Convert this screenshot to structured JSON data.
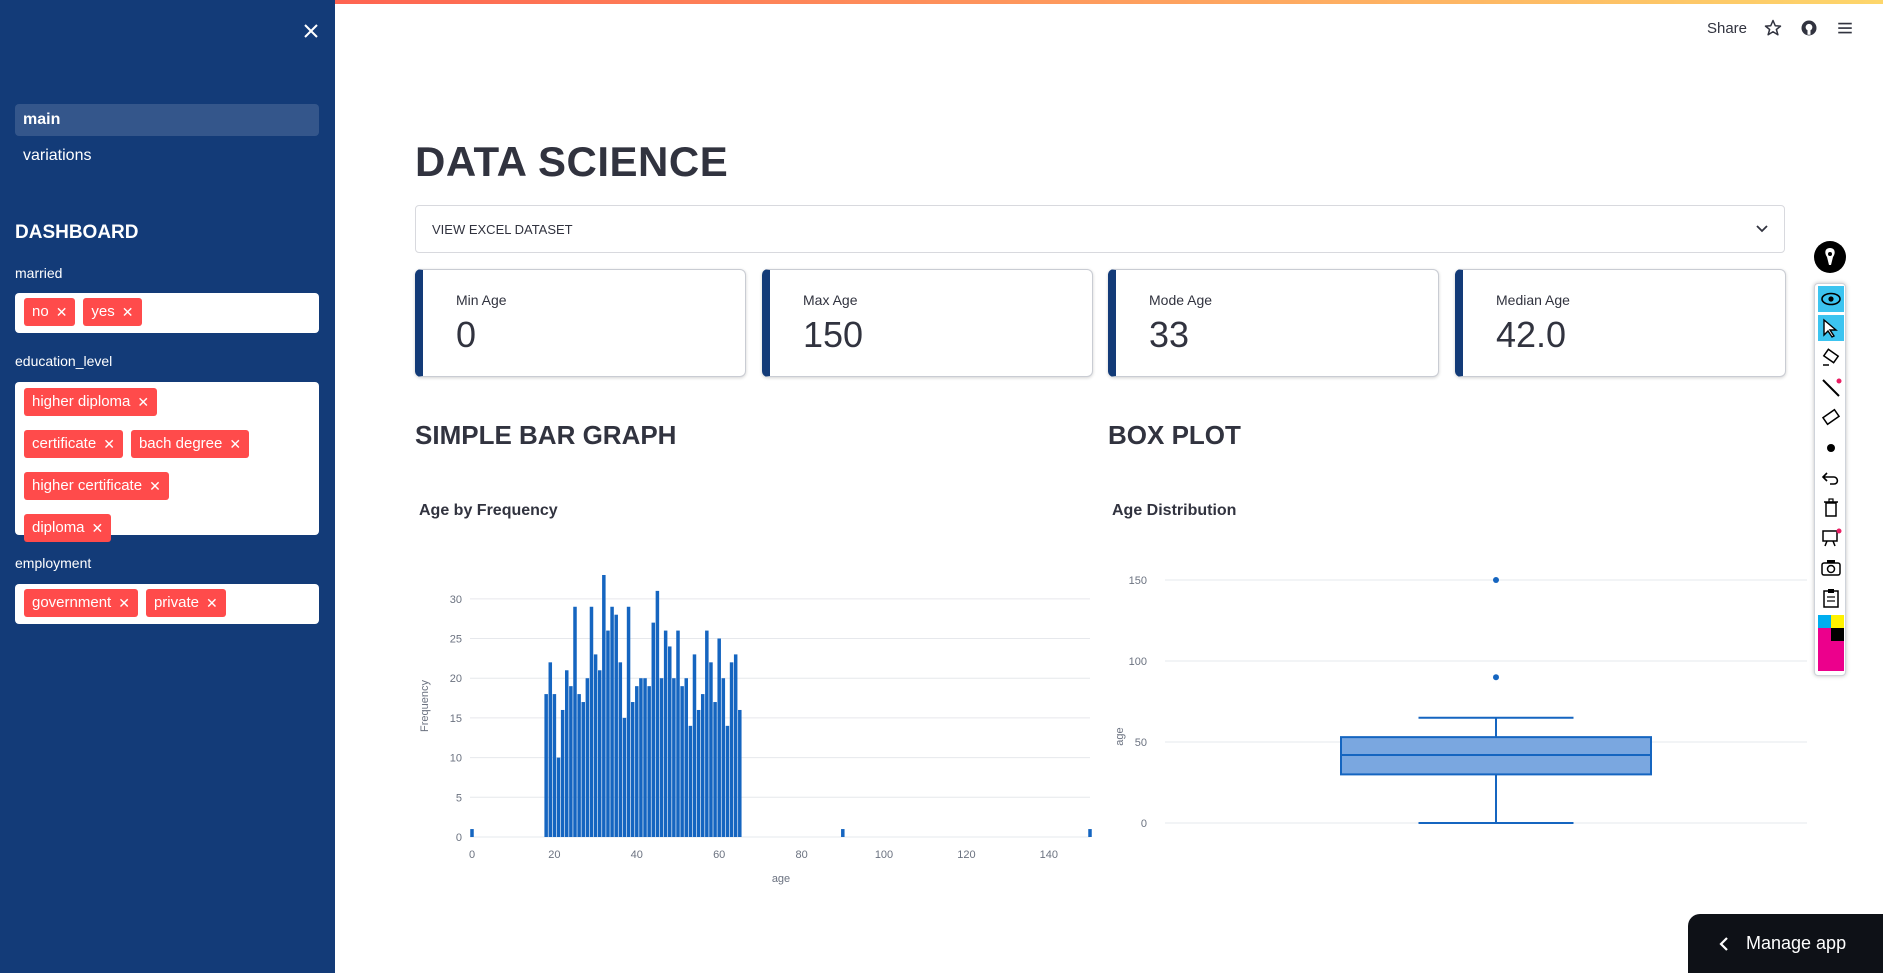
{
  "sidebar": {
    "nav": [
      {
        "label": "main",
        "active": true
      },
      {
        "label": "variations",
        "active": false
      }
    ],
    "heading": "DASHBOARD",
    "filters": [
      {
        "label": "married",
        "tags": [
          "no",
          "yes"
        ]
      },
      {
        "label": "education_level",
        "tags": [
          "higher diploma",
          "certificate",
          "bach degree",
          "higher certificate",
          "diploma"
        ]
      },
      {
        "label": "employment",
        "tags": [
          "government",
          "private"
        ]
      }
    ],
    "close_icon": "close-icon"
  },
  "header": {
    "share_label": "Share",
    "icons": [
      "star-icon",
      "github-icon",
      "hamburger-menu-icon"
    ]
  },
  "main": {
    "title": "DATA SCIENCE",
    "expander_label": "VIEW EXCEL DATASET",
    "metrics": [
      {
        "label": "Min Age",
        "value": "0"
      },
      {
        "label": "Max Age",
        "value": "150"
      },
      {
        "label": "Mode Age",
        "value": "33"
      },
      {
        "label": "Median Age",
        "value": "42.0"
      }
    ],
    "bar_section_title": "SIMPLE BAR GRAPH",
    "box_section_title": "BOX PLOT"
  },
  "chart_data": [
    {
      "type": "bar",
      "title": "Age by Frequency",
      "xlabel": "age",
      "ylabel": "Frequency",
      "xlim": [
        0,
        150
      ],
      "ylim": [
        0,
        33
      ],
      "xticks": [
        0,
        20,
        40,
        60,
        80,
        100,
        120,
        140
      ],
      "yticks": [
        0,
        5,
        10,
        15,
        20,
        25,
        30
      ],
      "x": [
        0,
        18,
        19,
        20,
        21,
        22,
        23,
        24,
        25,
        26,
        27,
        28,
        29,
        30,
        31,
        32,
        33,
        34,
        35,
        36,
        37,
        38,
        39,
        40,
        41,
        42,
        43,
        44,
        45,
        46,
        47,
        48,
        49,
        50,
        51,
        52,
        53,
        54,
        55,
        56,
        57,
        58,
        59,
        60,
        61,
        62,
        63,
        64,
        65,
        90,
        150
      ],
      "values": [
        1,
        18,
        22,
        18,
        10,
        16,
        21,
        19,
        29,
        18,
        17,
        20,
        29,
        23,
        21,
        33,
        26,
        29,
        28,
        22,
        15,
        29,
        17,
        19,
        20,
        20,
        19,
        27,
        31,
        20,
        26,
        24,
        20,
        26,
        19,
        20,
        14,
        23,
        16,
        18,
        26,
        22,
        17,
        25,
        20,
        14,
        22,
        23,
        16,
        1,
        1
      ],
      "bar_color": "#1565c0",
      "grid": true
    },
    {
      "type": "box",
      "title": "Age Distribution",
      "ylabel": "age",
      "ylim": [
        0,
        150
      ],
      "yticks": [
        0,
        50,
        100,
        150
      ],
      "min": 0,
      "q1": 30,
      "median": 42,
      "q3": 53,
      "max": 65,
      "outliers": [
        90,
        150
      ],
      "box_color": "#1565c0",
      "grid": true
    }
  ],
  "toolbar": {
    "icons": [
      "pen-icon",
      "eye-icon",
      "cursor-icon",
      "highlighter-icon",
      "line-icon",
      "eraser-icon",
      "dot-icon",
      "undo-icon",
      "trash-icon",
      "whiteboard-icon",
      "camera-icon",
      "clipboard-icon",
      "color-palette-icon"
    ]
  },
  "manage_app": {
    "label": "Manage app"
  }
}
